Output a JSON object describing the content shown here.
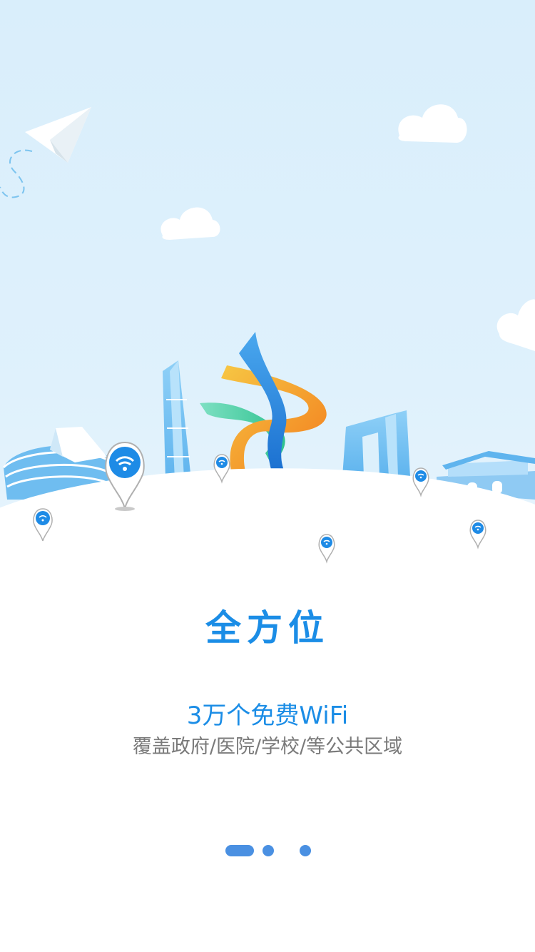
{
  "onboarding": {
    "title": "全方位",
    "subtitle": "3万个免费WiFi",
    "description": "覆盖政府/医院/学校/等公共区域"
  },
  "pager": {
    "total": 3,
    "current": 1
  },
  "colors": {
    "accent": "#1b8de6",
    "sky": "#dbeffb",
    "dot": "#4a90e2",
    "text_secondary": "#7a7a7a"
  },
  "icons": [
    "paper-plane-icon",
    "cloud-icon",
    "wifi-pin-icon",
    "stadium-icon",
    "tower-icon",
    "ribbon-sculpture-icon",
    "gate-building-icon",
    "pavilion-icon"
  ]
}
